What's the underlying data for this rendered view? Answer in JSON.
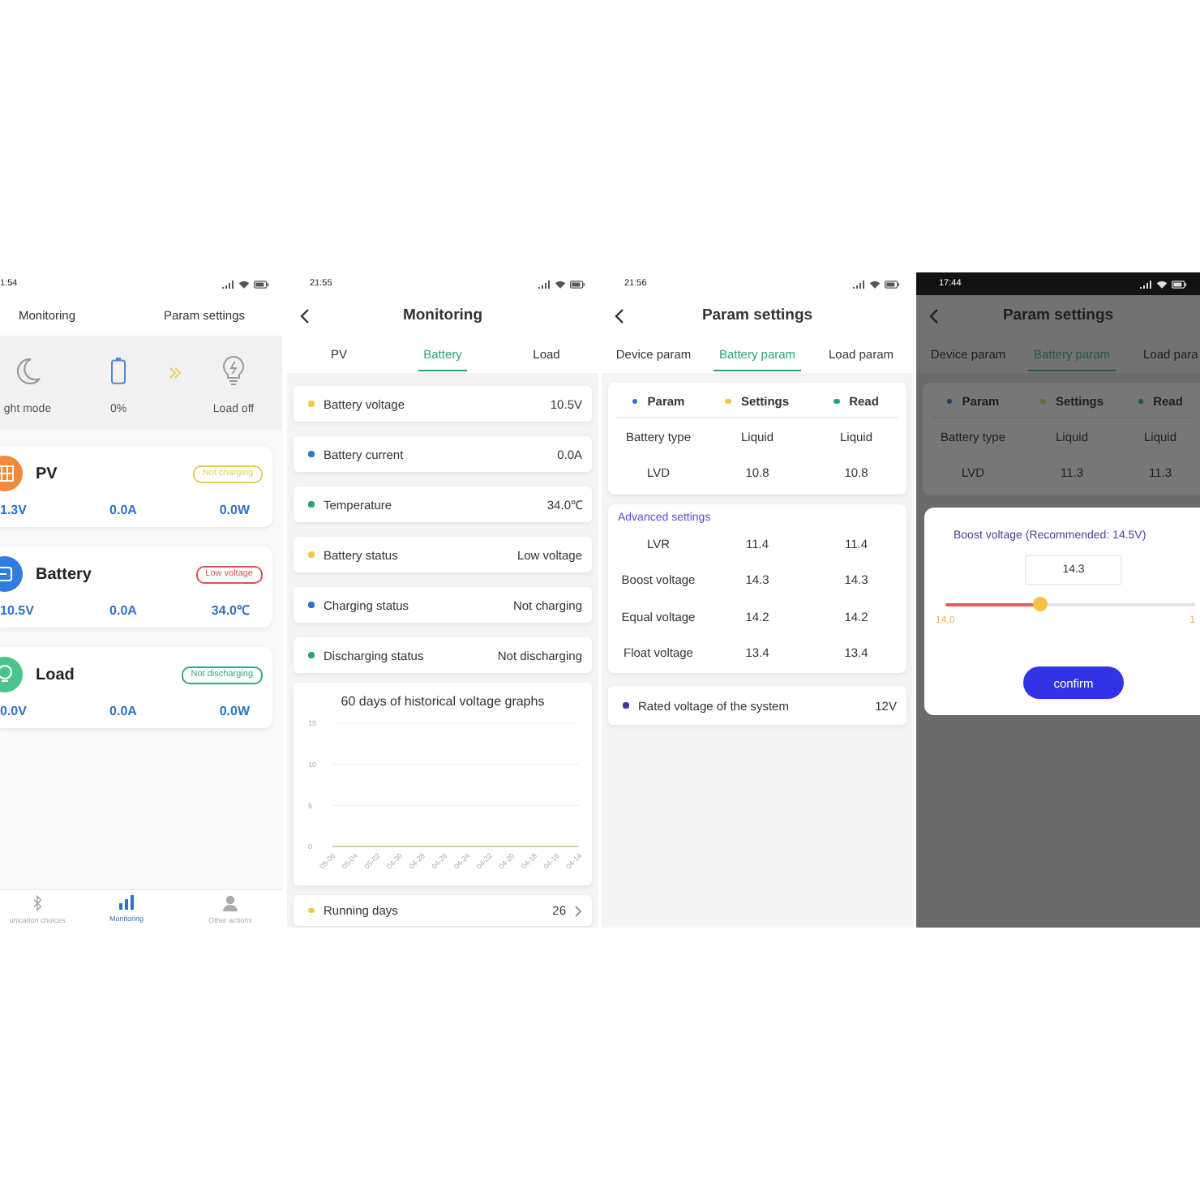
{
  "home_screen": {
    "status_bar": {
      "time": "1:54"
    },
    "top_tabs": [
      {
        "label": "Monitoring",
        "selected": false
      },
      {
        "label": "Param settings",
        "selected": false
      }
    ],
    "modes": [
      {
        "kind": "night",
        "label": "ght mode"
      },
      {
        "kind": "battery",
        "label": "0%"
      },
      {
        "kind": "load",
        "label": "Load off"
      }
    ],
    "cards": [
      {
        "kind": "pv",
        "title": "PV",
        "color": "#f08a3c",
        "badge": {
          "text": "Not charging",
          "color": "#e3cf5a"
        },
        "values": [
          "1.3V",
          "0.0A",
          "0.0W"
        ]
      },
      {
        "kind": "battery",
        "title": "Battery",
        "color": "#2f7de1",
        "badge": {
          "text": "Low voltage",
          "color": "#d9534f"
        },
        "values": [
          "10.5V",
          "0.0A",
          "34.0℃"
        ]
      },
      {
        "kind": "load",
        "title": "Load",
        "color": "#4cc38a",
        "badge": {
          "text": "Not discharging",
          "color": "#3aa57a"
        },
        "values": [
          "0.0V",
          "0.0A",
          "0.0W"
        ]
      }
    ],
    "bottom_nav": [
      {
        "kind": "bluetooth",
        "label": "unication choices",
        "selected": false
      },
      {
        "kind": "chart",
        "label": "Monitoring",
        "selected": true
      },
      {
        "kind": "person",
        "label": "Other actions",
        "selected": false
      }
    ]
  },
  "battery_screen": {
    "status_bar": {
      "time": "21:55"
    },
    "title": "Monitoring",
    "tabs": [
      {
        "label": "PV",
        "selected": false
      },
      {
        "label": "Battery",
        "selected": true
      },
      {
        "label": "Load",
        "selected": false
      }
    ],
    "readings": [
      {
        "label": "Battery voltage",
        "value": "10.5V",
        "color": "#f2c94c"
      },
      {
        "label": "Battery current",
        "value": "0.0A",
        "color": "#2f73c9"
      },
      {
        "label": "Temperature",
        "value": "34.0℃",
        "color": "#27a37b"
      },
      {
        "label": "Battery status",
        "value": "Low voltage",
        "color": "#f2c94c"
      },
      {
        "label": "Charging status",
        "value": "Not charging",
        "color": "#2f73c9"
      },
      {
        "label": "Discharging status",
        "value": "Not discharging",
        "color": "#27a37b"
      }
    ],
    "history": {
      "chart_data": {
        "type": "line",
        "title": "60 days of historical voltage graphs",
        "categories": [
          "05-06",
          "05-04",
          "05-02",
          "04-30",
          "04-28",
          "04-26",
          "04-24",
          "04-22",
          "04-20",
          "04-18",
          "04-16",
          "04-14"
        ],
        "series": [
          {
            "color": "#d8d28a",
            "values": [
              0,
              0,
              0,
              0,
              0,
              0,
              0,
              0,
              0,
              0,
              0,
              0
            ]
          }
        ],
        "ylim": [
          0,
          15
        ],
        "yticks": [
          0,
          5,
          10,
          15
        ]
      }
    },
    "link_row": {
      "label": "Running days",
      "value": "26",
      "color": "#f2c94c"
    }
  },
  "param_screen": {
    "status_bar": {
      "time": "21:56"
    },
    "title": "Param settings",
    "tabs": [
      {
        "label": "Device param",
        "selected": false
      },
      {
        "label": "Battery param",
        "selected": true
      },
      {
        "label": "Load param",
        "selected": false
      }
    ],
    "table": {
      "columns": [
        {
          "label": "Param",
          "color": "#2f73c9"
        },
        {
          "label": "Settings",
          "color": "#f2c94c"
        },
        {
          "label": "Read",
          "color": "#27a37b"
        }
      ],
      "rows": [
        [
          "Battery type",
          "Liquid",
          "Liquid"
        ],
        [
          "LVD",
          "10.8",
          "10.8"
        ]
      ]
    },
    "advanced": {
      "title": "Advanced settings",
      "rows": [
        [
          "LVR",
          "11.4",
          "11.4"
        ],
        [
          "Boost voltage",
          "14.3",
          "14.3"
        ],
        [
          "Equal voltage",
          "14.2",
          "14.2"
        ],
        [
          "Float voltage",
          "13.4",
          "13.4"
        ]
      ]
    },
    "system_row": {
      "label": "Rated voltage of the system",
      "value": "12V",
      "color": "#3d36a8"
    }
  },
  "dialog_screen": {
    "status_bar": {
      "time": "17:44",
      "dark": true
    },
    "dimmed": true,
    "title": "Param settings",
    "tabs": [
      {
        "label": "Device param",
        "selected": false
      },
      {
        "label": "Battery param",
        "selected": true
      },
      {
        "label": "Load para",
        "selected": false
      }
    ],
    "table": {
      "columns": [
        {
          "label": "Param",
          "color": "#1e3e66"
        },
        {
          "label": "Settings",
          "color": "#6e6a3a"
        },
        {
          "label": "Read",
          "color": "#1e5a48"
        }
      ],
      "rows": [
        [
          "Battery type",
          "Liquid",
          "Liquid"
        ],
        [
          "LVD",
          "11.3",
          "11.3"
        ]
      ]
    },
    "dialog": {
      "title": "Boost voltage (Recommended: 14.5V)",
      "value": "14.3",
      "slider": {
        "level": 0.38,
        "min_label": "14.0",
        "max_label": "1"
      },
      "button": "confirm"
    }
  }
}
